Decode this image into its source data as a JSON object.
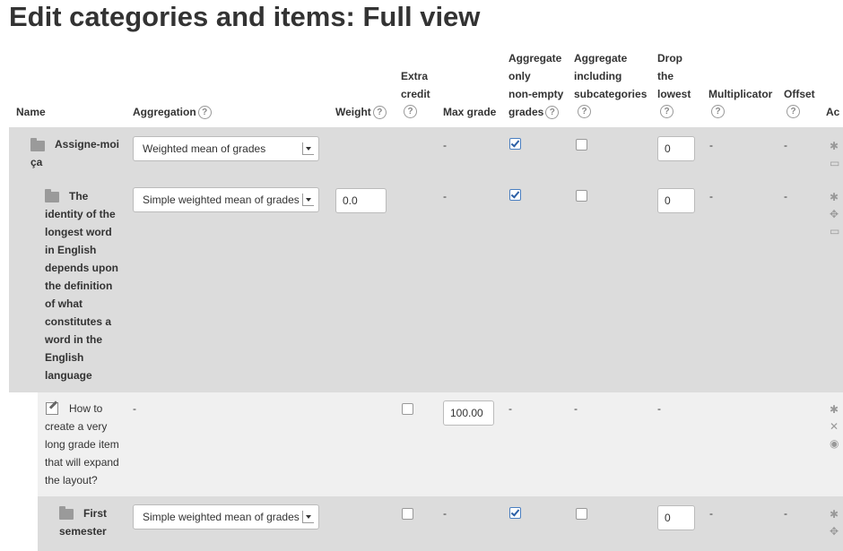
{
  "page_title": "Edit categories and items: Full view",
  "columns": {
    "name": "Name",
    "aggregation": "Aggregation",
    "weight": "Weight",
    "extra_credit_1": "Extra",
    "extra_credit_2": "credit",
    "max_grade": "Max grade",
    "agg_only_1": "Aggregate",
    "agg_only_2": "only",
    "agg_only_3": "non-empty",
    "agg_only_4": "grades",
    "agg_incl_1": "Aggregate",
    "agg_incl_2": "including",
    "agg_incl_3": "subcategories",
    "drop_1": "Drop",
    "drop_2": "the",
    "drop_3": "lowest",
    "multiplicator": "Multiplicator",
    "offset": "Offset",
    "actions_partial": "Ac"
  },
  "help_glyph": "?",
  "dash": "-",
  "rows": [
    {
      "type": "category",
      "name_lines": [
        "Assigne-moi",
        "ça"
      ],
      "aggregation": "Weighted mean of grades",
      "max_grade": "-",
      "agg_only_checked": true,
      "agg_incl_checked": false,
      "drop_lowest": "0",
      "multiplicator": "-",
      "offset": "-"
    },
    {
      "type": "category",
      "name_lines": [
        "The",
        "identity of the",
        "longest word",
        "in English",
        "depends upon",
        "the definition",
        "of what",
        "constitutes a",
        "word in the",
        "English",
        "language"
      ],
      "aggregation": "Simple weighted mean of grades",
      "weight": "0.0",
      "max_grade": "-",
      "agg_only_checked": true,
      "agg_incl_checked": false,
      "drop_lowest": "0",
      "multiplicator": "-",
      "offset": "-"
    },
    {
      "type": "item",
      "name_lines": [
        "How to",
        "create a very",
        "long grade item",
        "that will expand",
        "the layout?"
      ],
      "aggregation": "-",
      "extra_credit_checked": false,
      "max_grade": "100.00",
      "agg_only": "-",
      "agg_incl": "-",
      "drop_lowest": "-"
    },
    {
      "type": "category",
      "name_lines": [
        "First",
        "semester"
      ],
      "aggregation": "Simple weighted mean of grades",
      "extra_credit_checked": false,
      "max_grade": "-",
      "agg_only_checked": true,
      "agg_incl_checked": false,
      "drop_lowest": "0",
      "multiplicator": "-",
      "offset": "-"
    }
  ]
}
